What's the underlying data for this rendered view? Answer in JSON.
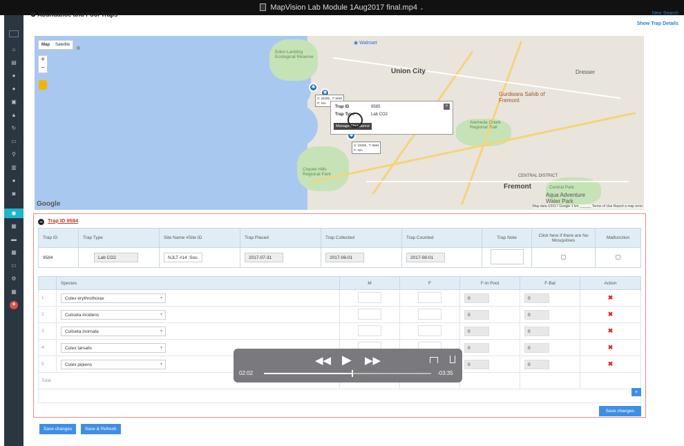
{
  "window": {
    "title": "MapVision Lab Module 1Aug2017 final.mp4"
  },
  "header": {
    "page_title": "Abundance and Pool Traps",
    "new_search": "New Search",
    "show_details": "Show Trap Details"
  },
  "map": {
    "type_map": "Map",
    "type_satellite": "Satellite",
    "zoom_in": "+",
    "zoom_out": "−",
    "labels": {
      "walmart": "Walmart",
      "union_city": "Union City",
      "fremont": "Fremont",
      "eden_landing": "Eden Landing Ecological Reserve",
      "coyote_hills": "Coyote Hills Regional Park",
      "alameda_creek": "Alameda Creek Regional Trail",
      "gurdwara": "Gurdwara Sahib of Fremont",
      "dresser": "Dresser",
      "central_district": "CENTRAL DISTRICT",
      "central_park": "Central Park",
      "aqua_adventure": "Aqua Adventure Water Park"
    },
    "google": "Google",
    "footer": "Map data ©2017 Google   1 km ______   Terms of Use   Report a map error",
    "mini_a_line1": "S: 26285 , T: 9584",
    "mini_a_line2": "P: N/A",
    "mini_b_line1": "S: 22008 , T: 9584",
    "mini_b_line2": "P: N/A",
    "popup": {
      "trap_id_label": "Trap ID",
      "trap_id_value": "9585",
      "trap_type_label": "Trap Type",
      "trap_type_value": "Lab CO2",
      "button": "Manage Abundance"
    }
  },
  "panel": {
    "heading": "Trap ID 9584",
    "trap_headers": [
      "Trap ID",
      "Trap Type",
      "Site Name #Site ID",
      "Trap Placed",
      "Trap Collected",
      "Trap Counted",
      "Trap Note",
      "Click here if there are No Mosquitoes",
      "Malfunction"
    ],
    "trap_row": {
      "id": "9584",
      "type": "Lab CO2",
      "site": "NJLT #14 :Sou",
      "placed": "2017-07-31",
      "collected": "2017-08-01",
      "counted": "2017-08-01"
    },
    "species_headers": {
      "species": "Species",
      "m": "M",
      "f": "F",
      "f_in_pool": "F-In Pool",
      "f_bal": "F-Bal",
      "action": "Action"
    },
    "species_rows": [
      {
        "n": "1",
        "name": "Culex erythrothorax",
        "pool": "0",
        "bal": "0"
      },
      {
        "n": "2",
        "name": "Culiseta incidens",
        "pool": "0",
        "bal": "0"
      },
      {
        "n": "3",
        "name": "Culiseta inornata",
        "pool": "0",
        "bal": "0"
      },
      {
        "n": "4",
        "name": "Culex tarsalis",
        "pool": "0",
        "bal": "0"
      },
      {
        "n": "5",
        "name": "Culex pipiens",
        "pool": "0",
        "bal": "0"
      }
    ],
    "total_label": "Total",
    "add_label": "+",
    "save_label": "Save changes"
  },
  "footer": {
    "save_changes": "Save changes",
    "save_refresh": "Save & Refresh"
  },
  "player": {
    "elapsed": "02:02",
    "remaining": "-03:35",
    "progress": 0.53
  }
}
